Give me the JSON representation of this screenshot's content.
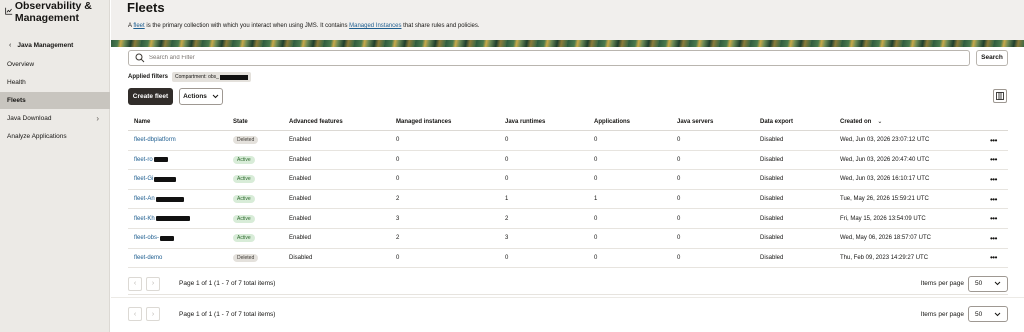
{
  "sidebar": {
    "app_title": "Observability & Management",
    "back_label": "Java Management",
    "items": [
      {
        "label": "Overview"
      },
      {
        "label": "Health"
      },
      {
        "label": "Fleets",
        "active": true
      },
      {
        "label": "Java Download",
        "has_submenu": true
      },
      {
        "label": "Analyze Applications"
      }
    ]
  },
  "header": {
    "title": "Fleets",
    "intro": {
      "prefix": "A ",
      "fleet_link": "fleet",
      "middle": " is the primary collection with which you interact when using JMS. It contains ",
      "mi_link": "Managed Instances",
      "suffix": " that share rules and policies."
    }
  },
  "search": {
    "placeholder": "Search and Filter",
    "button_label": "Search"
  },
  "filters": {
    "label": "Applied filters",
    "chip_text": "Compartment: obs_"
  },
  "toolbar": {
    "create_label": "Create fleet",
    "actions_label": "Actions"
  },
  "table": {
    "columns": [
      "Name",
      "State",
      "Advanced features",
      "Managed instances",
      "Java runtimes",
      "Applications",
      "Java servers",
      "Data export",
      "Created on"
    ],
    "rows": [
      {
        "name": "fleet-dbplatform",
        "state": "Deleted",
        "advanced": "Enabled",
        "mi": "0",
        "jr": "0",
        "apps": "0",
        "js": "0",
        "export": "Disabled",
        "created": "Wed, Jun 03, 2026 23:07:12 UTC"
      },
      {
        "name": "fleet-ro",
        "state": "Active",
        "advanced": "Enabled",
        "mi": "0",
        "jr": "0",
        "apps": "0",
        "js": "0",
        "export": "Disabled",
        "created": "Wed, Jun 03, 2026 20:47:40 UTC"
      },
      {
        "name": "fleet-Gi",
        "state": "Active",
        "advanced": "Enabled",
        "mi": "0",
        "jr": "0",
        "apps": "0",
        "js": "0",
        "export": "Disabled",
        "created": "Wed, Jun 03, 2026 16:10:17 UTC"
      },
      {
        "name": "fleet-An",
        "state": "Active",
        "advanced": "Enabled",
        "mi": "2",
        "jr": "1",
        "apps": "1",
        "js": "0",
        "export": "Disabled",
        "created": "Tue, May 26, 2026 15:59:21 UTC"
      },
      {
        "name": "fleet-Kh",
        "state": "Active",
        "advanced": "Enabled",
        "mi": "3",
        "jr": "2",
        "apps": "0",
        "js": "0",
        "export": "Disabled",
        "created": "Fri, May 15, 2026 13:54:09 UTC"
      },
      {
        "name": "fleet-obs-",
        "state": "Active",
        "advanced": "Enabled",
        "mi": "2",
        "jr": "3",
        "apps": "0",
        "js": "0",
        "export": "Disabled",
        "created": "Wed, May 06, 2026 18:57:07 UTC"
      },
      {
        "name": "fleet-demo",
        "state": "Deleted",
        "advanced": "Disabled",
        "mi": "0",
        "jr": "0",
        "apps": "0",
        "js": "0",
        "export": "Disabled",
        "created": "Thu, Feb 09, 2023 14:29:27 UTC"
      }
    ]
  },
  "pagination": {
    "text": "Page 1 of 1 (1 - 7 of 7 total items)",
    "items_per_page_label": "Items per page",
    "items_per_page": "50"
  },
  "icons": {
    "more": "more-actions-icon",
    "search": "search-icon",
    "columns": "columns-icon"
  }
}
